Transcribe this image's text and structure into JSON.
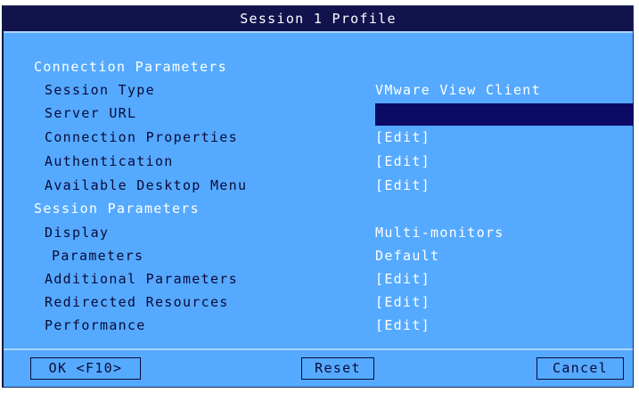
{
  "window": {
    "title": "Session 1 Profile"
  },
  "connection": {
    "header": "Connection Parameters",
    "session_type": {
      "label": "Session Type",
      "value": "VMware View Client"
    },
    "server_url": {
      "label": "Server URL",
      "value": ""
    },
    "connection_properties": {
      "label": "Connection Properties",
      "value": "[Edit]"
    },
    "authentication": {
      "label": "Authentication",
      "value": "[Edit]"
    },
    "desktop_menu": {
      "label": "Available Desktop Menu",
      "value": "[Edit]"
    }
  },
  "session": {
    "header": "Session Parameters",
    "display": {
      "label": "Display",
      "value": "Multi-monitors"
    },
    "parameters": {
      "label": "Parameters",
      "value": "Default"
    },
    "additional": {
      "label": "Additional Parameters",
      "value": "[Edit]"
    },
    "redirected": {
      "label": "Redirected Resources",
      "value": "[Edit]"
    },
    "performance": {
      "label": "Performance",
      "value": "[Edit]"
    }
  },
  "buttons": {
    "ok": "OK <F10>",
    "reset": "Reset",
    "cancel": "Cancel"
  },
  "colors": {
    "background": "#55aaff",
    "titlebar": "#12124d",
    "input_bg": "#0b0b66",
    "label_text": "#0a0a3a",
    "value_text": "#ffffff"
  }
}
